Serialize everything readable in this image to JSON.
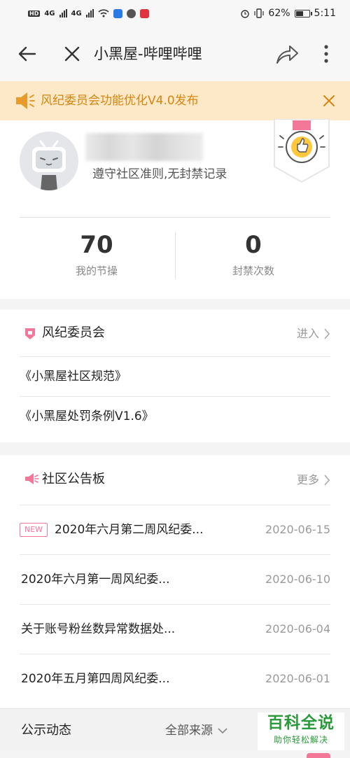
{
  "status_bar": {
    "network": "4G",
    "battery": "62%",
    "battery_level": 0.62,
    "time": "5:11"
  },
  "title_bar": {
    "title": "小黑屋-哔哩哔哩"
  },
  "notice": {
    "text": "风纪委员会功能优化V4.0发布"
  },
  "profile": {
    "record_text": "遵守社区准则,无封禁记录",
    "stats": [
      {
        "value": "70",
        "label": "我的节操"
      },
      {
        "value": "0",
        "label": "封禁次数"
      }
    ]
  },
  "committee": {
    "title": "风纪委员会",
    "action": "进入",
    "links": [
      "《小黑屋社区规范》",
      "《小黑屋处罚条例V1.6》"
    ]
  },
  "bulletin": {
    "title": "社区公告板",
    "action": "更多",
    "badge": "NEW",
    "items": [
      {
        "title": "2020年六月第二周风纪委...",
        "date": "2020-06-15"
      },
      {
        "title": "2020年六月第一周风纪委...",
        "date": "2020-06-10"
      },
      {
        "title": "关于账号粉丝数异常数据处...",
        "date": "2020-06-04"
      },
      {
        "title": "2020年五月第四周风纪委...",
        "date": "2020-06-01"
      }
    ]
  },
  "bottom_bar": {
    "label": "公示动态",
    "filter": "全部来源"
  },
  "watermark": {
    "big": "百科全说",
    "small": "助你轻松解决"
  },
  "colors": {
    "accent_pink": "#f27799",
    "notice_orange": "#d6850f",
    "notice_bg": "#fde9c8"
  }
}
